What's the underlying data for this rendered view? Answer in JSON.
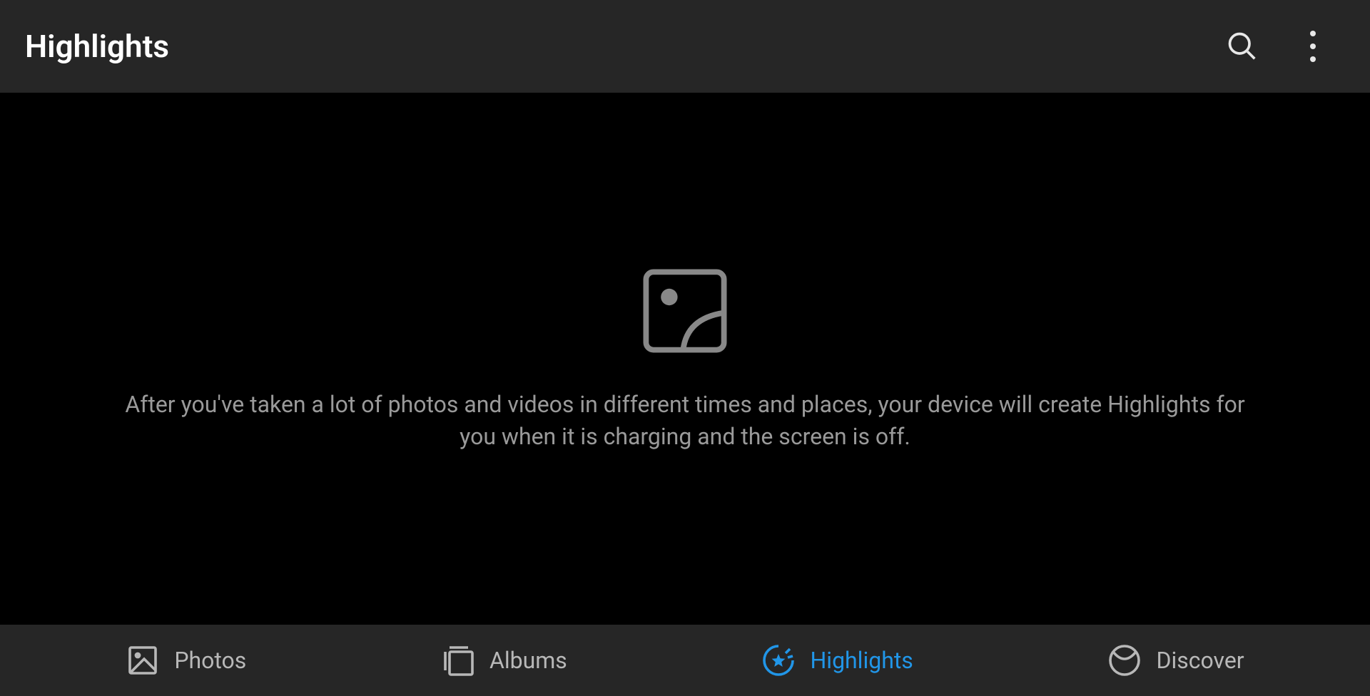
{
  "header": {
    "title": "Highlights"
  },
  "main": {
    "empty_description": "After you've taken a lot of photos and videos in different times and places, your device will create Highlights for you when it is charging and the screen is off."
  },
  "bottom_nav": {
    "items": [
      {
        "label": "Photos",
        "icon": "photo-icon",
        "active": false
      },
      {
        "label": "Albums",
        "icon": "album-icon",
        "active": false
      },
      {
        "label": "Highlights",
        "icon": "highlights-icon",
        "active": true
      },
      {
        "label": "Discover",
        "icon": "discover-icon",
        "active": false
      }
    ]
  }
}
